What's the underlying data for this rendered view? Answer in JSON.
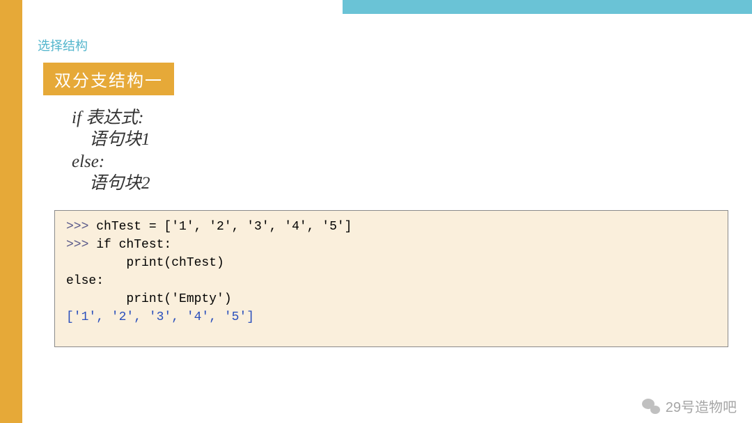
{
  "header": {
    "page_title": "选择结构",
    "section_title": "双分支结构一"
  },
  "pseudo": {
    "line1": "if 表达式:",
    "line2": "    语句块1",
    "line3": "else:",
    "line4": "    语句块2"
  },
  "code": {
    "prompt": ">>> ",
    "line1": "chTest = ['1', '2', '3', '4', '5']",
    "line2": "if chTest:",
    "line3": "        print(chTest)",
    "line4": "else:",
    "line5": "        print('Empty')",
    "output": "['1', '2', '3', '4', '5']"
  },
  "watermark": {
    "text": "29号造物吧"
  },
  "colors": {
    "orange": "#e6a938",
    "cyan": "#6ac3d6",
    "panel": "#faefdc",
    "title_text": "#52b5cc"
  }
}
